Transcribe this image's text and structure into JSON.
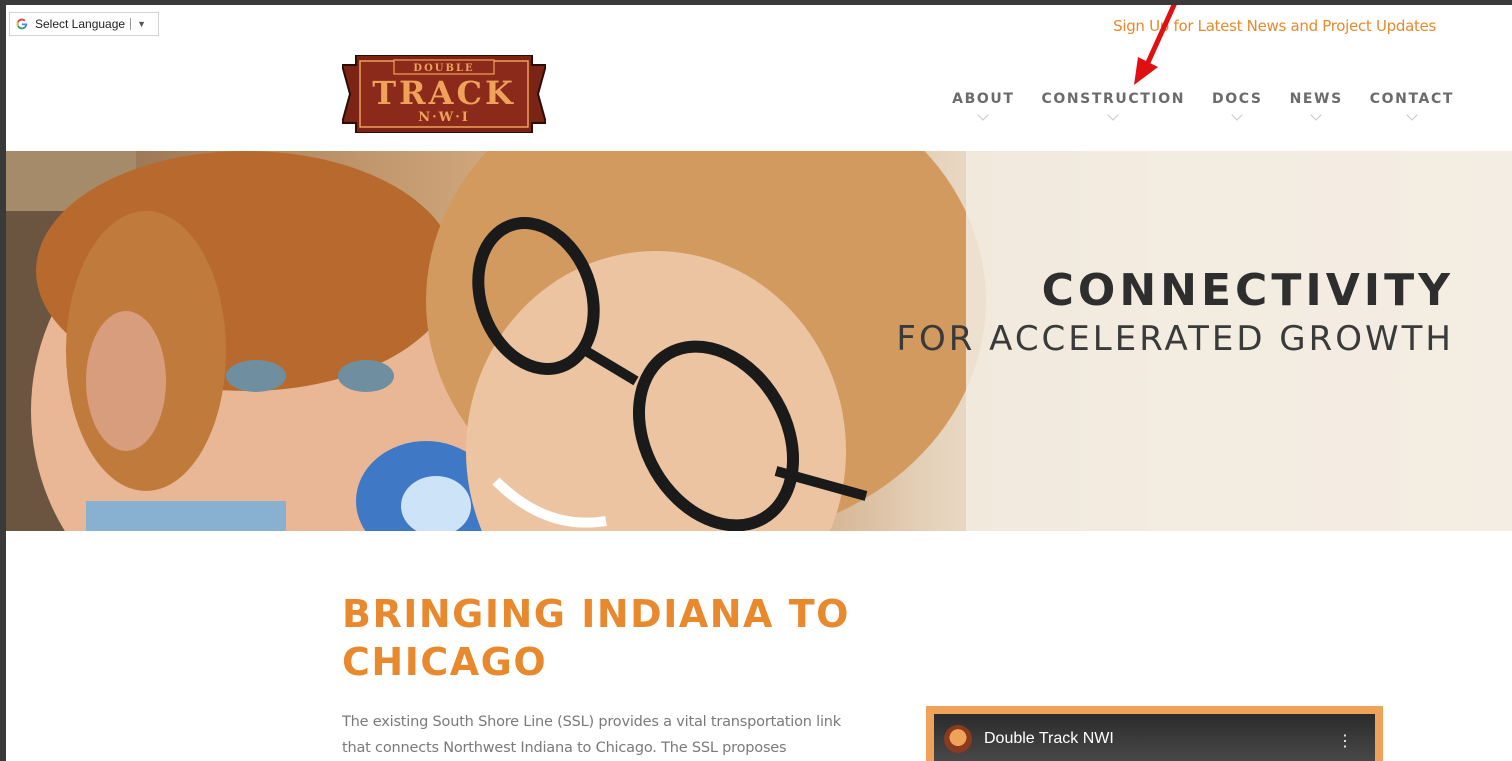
{
  "language_widget": {
    "label": "Select Language",
    "arrow": "▼"
  },
  "header": {
    "signup_text": "Sign Up for Latest News and Project Updates",
    "logo": {
      "top": "DOUBLE",
      "main": "TRACK",
      "sub": "N·W·I"
    },
    "nav": [
      {
        "label": "ABOUT"
      },
      {
        "label": "CONSTRUCTION"
      },
      {
        "label": "DOCS"
      },
      {
        "label": "NEWS"
      },
      {
        "label": "CONTACT"
      }
    ]
  },
  "hero": {
    "title": "CONNECTIVITY",
    "subtitle": "FOR ACCELERATED GROWTH"
  },
  "section": {
    "title": "BRINGING INDIANA TO CHICAGO",
    "body": "The existing South Shore Line (SSL) provides a vital transportation link that connects Northwest Indiana to Chicago. The SSL proposes"
  },
  "video": {
    "channel_title": "Double Track NWI",
    "menu_icon": "⋮"
  },
  "colors": {
    "accent": "#e8892e",
    "logo_red": "#8b2a1a",
    "logo_gold": "#f0a25a",
    "nav_text": "#6b6b6b",
    "annotation_red": "#e01010"
  }
}
